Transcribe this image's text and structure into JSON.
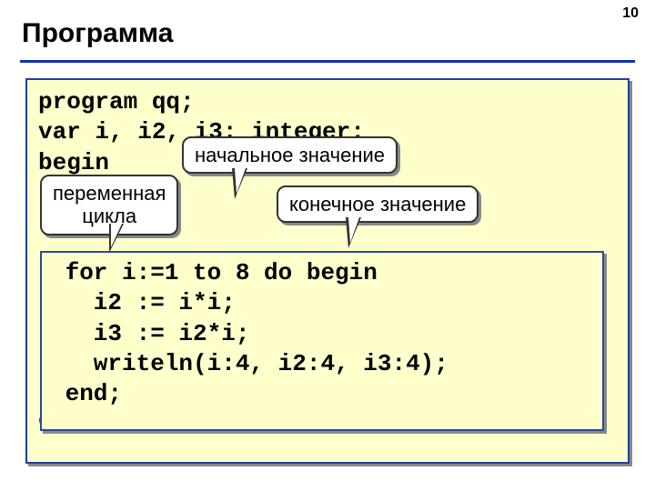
{
  "page_number": "10",
  "title": "Программа",
  "code": {
    "l1": "program qq;",
    "l2": "var i, i2, i3: integer;",
    "l3": "begin",
    "l11": "end."
  },
  "inner_code": {
    "l1": " for i:=1 to 8 do begin",
    "l2": "   i2 := i*i;",
    "l3": "   i3 := i2*i;",
    "l4": "   writeln(i:4, i2:4, i3:4);",
    "l5": " end;"
  },
  "callouts": {
    "loop_var_l1": "переменная",
    "loop_var_l2": "цикла",
    "start_val": "начальное значение",
    "end_val": "конечное значение"
  }
}
